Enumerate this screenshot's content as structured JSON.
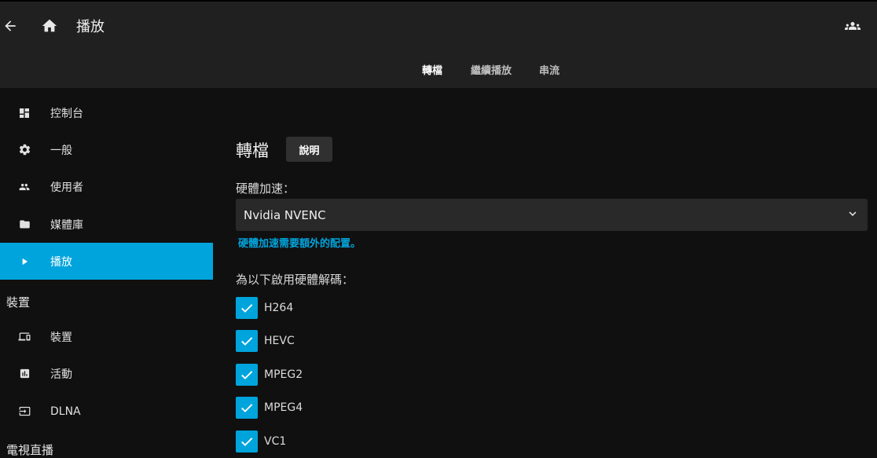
{
  "header": {
    "title": "播放",
    "tabs": [
      {
        "label": "轉檔",
        "active": true
      },
      {
        "label": "繼續播放",
        "active": false
      },
      {
        "label": "串流",
        "active": false
      }
    ]
  },
  "sidebar": {
    "items_top": [
      {
        "label": "控制台",
        "icon": "dashboard-icon"
      },
      {
        "label": "一般",
        "icon": "gear-icon"
      },
      {
        "label": "使用者",
        "icon": "users-icon"
      },
      {
        "label": "媒體庫",
        "icon": "folder-icon"
      },
      {
        "label": "播放",
        "icon": "play-icon",
        "active": true
      }
    ],
    "section_devices": "裝置",
    "items_devices": [
      {
        "label": "裝置",
        "icon": "devices-icon"
      },
      {
        "label": "活動",
        "icon": "activity-icon"
      },
      {
        "label": "DLNA",
        "icon": "dlna-icon"
      }
    ],
    "section_livetv": "電視直播"
  },
  "content": {
    "title": "轉檔",
    "help_label": "說明",
    "hw_accel_label": "硬體加速：",
    "hw_accel_value": "Nvidia NVENC",
    "hw_accel_hint": "硬體加速需要額外的配置。",
    "decoding_label": "為以下啟用硬體解碼：",
    "codecs": [
      {
        "label": "H264",
        "checked": true
      },
      {
        "label": "HEVC",
        "checked": true
      },
      {
        "label": "MPEG2",
        "checked": true
      },
      {
        "label": "MPEG4",
        "checked": true
      },
      {
        "label": "VC1",
        "checked": true
      }
    ]
  },
  "colors": {
    "accent": "#00a4dc",
    "header_bg": "#202020",
    "page_bg": "#101010"
  }
}
